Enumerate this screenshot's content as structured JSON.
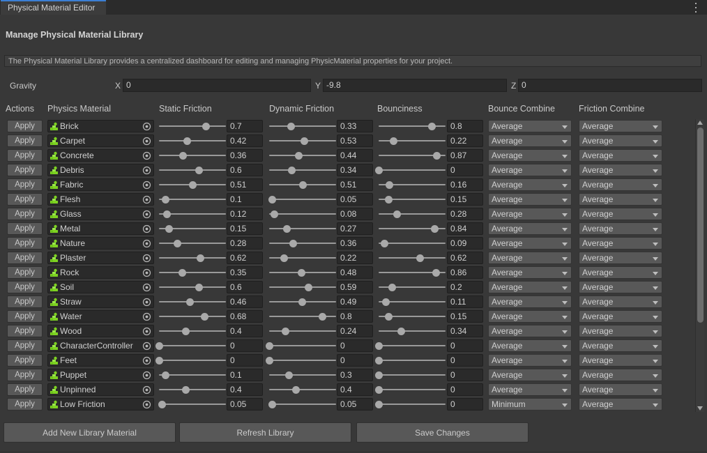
{
  "window": {
    "tab_label": "Physical Material Editor",
    "menu_icon": "kebab-menu-icon"
  },
  "header": {
    "section_title": "Manage Physical Material Library",
    "help_text": "The Physical Material Library provides a centralized dashboard for editing and managing PhysicMaterial properties for your project."
  },
  "gravity": {
    "label": "Gravity",
    "x_label": "X",
    "x_value": "0",
    "y_label": "Y",
    "y_value": "-9.8",
    "z_label": "Z",
    "z_value": "0"
  },
  "table": {
    "columns": [
      "Actions",
      "Physics Material",
      "Static Friction",
      "Dynamic Friction",
      "Bounciness",
      "Bounce Combine",
      "Friction Combine"
    ],
    "apply_label": "Apply",
    "rows": [
      {
        "name": "Brick",
        "static_friction": "0.7",
        "dynamic_friction": "0.33",
        "bounciness": "0.8",
        "bounce_combine": "Average",
        "friction_combine": "Average"
      },
      {
        "name": "Carpet",
        "static_friction": "0.42",
        "dynamic_friction": "0.53",
        "bounciness": "0.22",
        "bounce_combine": "Average",
        "friction_combine": "Average"
      },
      {
        "name": "Concrete",
        "static_friction": "0.36",
        "dynamic_friction": "0.44",
        "bounciness": "0.87",
        "bounce_combine": "Average",
        "friction_combine": "Average"
      },
      {
        "name": "Debris",
        "static_friction": "0.6",
        "dynamic_friction": "0.34",
        "bounciness": "0",
        "bounce_combine": "Average",
        "friction_combine": "Average"
      },
      {
        "name": "Fabric",
        "static_friction": "0.51",
        "dynamic_friction": "0.51",
        "bounciness": "0.16",
        "bounce_combine": "Average",
        "friction_combine": "Average"
      },
      {
        "name": "Flesh",
        "static_friction": "0.1",
        "dynamic_friction": "0.05",
        "bounciness": "0.15",
        "bounce_combine": "Average",
        "friction_combine": "Average"
      },
      {
        "name": "Glass",
        "static_friction": "0.12",
        "dynamic_friction": "0.08",
        "bounciness": "0.28",
        "bounce_combine": "Average",
        "friction_combine": "Average"
      },
      {
        "name": "Metal",
        "static_friction": "0.15",
        "dynamic_friction": "0.27",
        "bounciness": "0.84",
        "bounce_combine": "Average",
        "friction_combine": "Average"
      },
      {
        "name": "Nature",
        "static_friction": "0.28",
        "dynamic_friction": "0.36",
        "bounciness": "0.09",
        "bounce_combine": "Average",
        "friction_combine": "Average"
      },
      {
        "name": "Plaster",
        "static_friction": "0.62",
        "dynamic_friction": "0.22",
        "bounciness": "0.62",
        "bounce_combine": "Average",
        "friction_combine": "Average"
      },
      {
        "name": "Rock",
        "static_friction": "0.35",
        "dynamic_friction": "0.48",
        "bounciness": "0.86",
        "bounce_combine": "Average",
        "friction_combine": "Average"
      },
      {
        "name": "Soil",
        "static_friction": "0.6",
        "dynamic_friction": "0.59",
        "bounciness": "0.2",
        "bounce_combine": "Average",
        "friction_combine": "Average"
      },
      {
        "name": "Straw",
        "static_friction": "0.46",
        "dynamic_friction": "0.49",
        "bounciness": "0.11",
        "bounce_combine": "Average",
        "friction_combine": "Average"
      },
      {
        "name": "Water",
        "static_friction": "0.68",
        "dynamic_friction": "0.8",
        "bounciness": "0.15",
        "bounce_combine": "Average",
        "friction_combine": "Average"
      },
      {
        "name": "Wood",
        "static_friction": "0.4",
        "dynamic_friction": "0.24",
        "bounciness": "0.34",
        "bounce_combine": "Average",
        "friction_combine": "Average"
      },
      {
        "name": "CharacterController",
        "static_friction": "0",
        "dynamic_friction": "0",
        "bounciness": "0",
        "bounce_combine": "Average",
        "friction_combine": "Average"
      },
      {
        "name": "Feet",
        "static_friction": "0",
        "dynamic_friction": "0",
        "bounciness": "0",
        "bounce_combine": "Average",
        "friction_combine": "Average"
      },
      {
        "name": "Puppet",
        "static_friction": "0.1",
        "dynamic_friction": "0.3",
        "bounciness": "0",
        "bounce_combine": "Average",
        "friction_combine": "Average"
      },
      {
        "name": "Unpinned",
        "static_friction": "0.4",
        "dynamic_friction": "0.4",
        "bounciness": "0",
        "bounce_combine": "Average",
        "friction_combine": "Average"
      },
      {
        "name": "Low Friction",
        "static_friction": "0.05",
        "dynamic_friction": "0.05",
        "bounciness": "0",
        "bounce_combine": "Minimum",
        "friction_combine": "Average"
      }
    ]
  },
  "footer": {
    "add_label": "Add New Library Material",
    "refresh_label": "Refresh Library",
    "save_label": "Save Changes"
  },
  "colors": {
    "background": "#383838",
    "tabbar": "#2b2b2b",
    "tab_accent": "#3b7fd4",
    "field": "#2a2a2a",
    "button": "#585858",
    "material_icon": "#7ed321"
  }
}
